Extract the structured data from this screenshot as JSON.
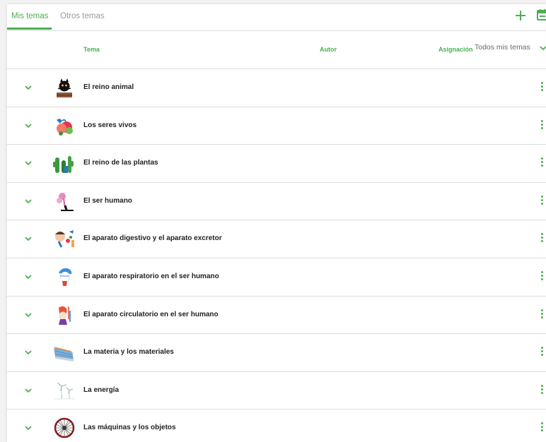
{
  "tabs": {
    "mine": "Mis temas",
    "others": "Otros temas"
  },
  "header": {
    "tema": "Tema",
    "autor": "Autor",
    "asignacion": "Asignación",
    "filter_value": "Todos mis temas"
  },
  "colors": {
    "accent": "#4caf50",
    "text": "#222222",
    "muted": "#9a9a9a",
    "divider": "#dcdcdc"
  },
  "topics": [
    {
      "title": "El reino animal"
    },
    {
      "title": "Los seres vivos"
    },
    {
      "title": "El reino de las plantas"
    },
    {
      "title": "El ser humano"
    },
    {
      "title": "El aparato digestivo y el aparato excretor"
    },
    {
      "title": "El aparato respiratorio en el ser humano"
    },
    {
      "title": "El aparato circulatorio en el ser humano"
    },
    {
      "title": "La materia y los materiales"
    },
    {
      "title": "La energía"
    },
    {
      "title": "Las máquinas y los objetos"
    }
  ]
}
